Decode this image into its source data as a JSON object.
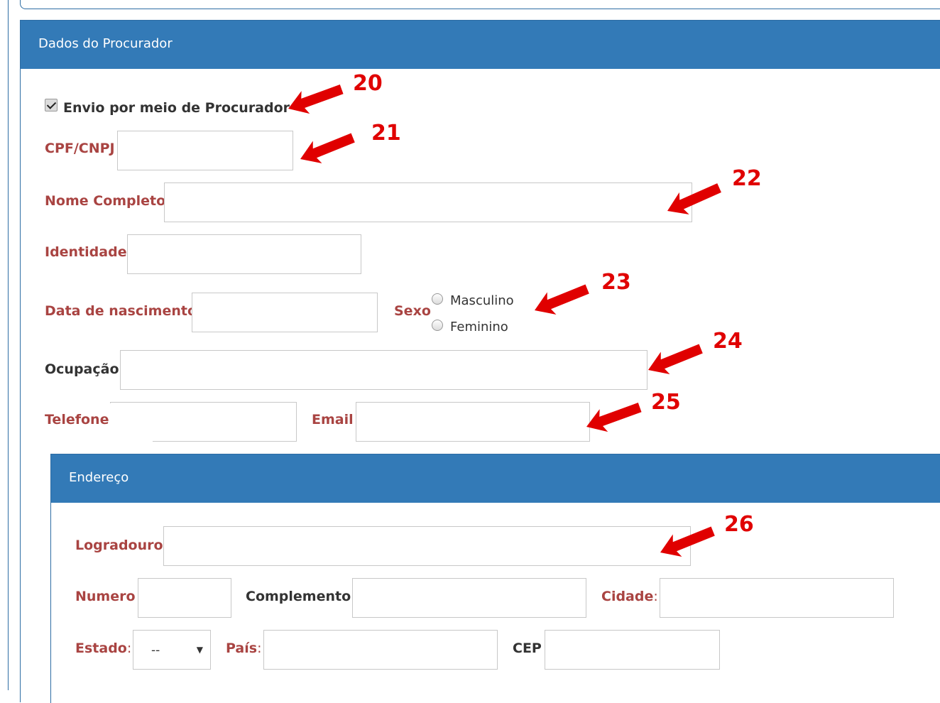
{
  "panel": {
    "title": "Dados do Procurador"
  },
  "checkbox": {
    "label": "Envio por meio de Procurador",
    "checked": true
  },
  "fields": {
    "cpf_label": "CPF/CNPJ",
    "nome_label": "Nome Completo",
    "identidade_label": "Identidade",
    "data_nasc_label": "Data de nascimento",
    "sexo_label": "Sexo",
    "sexo_options": [
      "Masculino",
      "Feminino"
    ],
    "ocupacao_label": "Ocupação",
    "telefone_label": "Telefone",
    "email_label": "Email"
  },
  "endereco": {
    "title": "Endereço",
    "logradouro_label": "Logradouro",
    "numero_label": "Numero",
    "complemento_label": "Complemento",
    "cidade_label": "Cidade",
    "estado_label": "Estado",
    "estado_value": "--",
    "pais_label": "País",
    "cep_label": "CEP",
    "colon": ":"
  },
  "annotations": [
    "20",
    "21",
    "22",
    "23",
    "24",
    "25",
    "26"
  ],
  "colors": {
    "panel_header": "#337ab7",
    "label_red": "#a94442",
    "annotation_red": "#e00000"
  }
}
